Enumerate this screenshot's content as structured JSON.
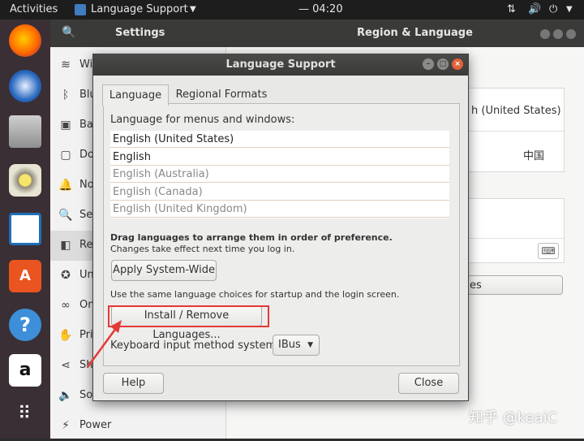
{
  "topbar": {
    "activities": "Activities",
    "app_menu": "Language Support",
    "clock": "— 04:20"
  },
  "settings": {
    "search_icon": "search-icon",
    "title": "Settings",
    "panel_title": "Region & Language",
    "sidebar": [
      {
        "label": "Wi",
        "icon": "wifi-icon"
      },
      {
        "label": "Blu",
        "icon": "bluetooth-icon"
      },
      {
        "label": "Ba",
        "icon": "background-icon"
      },
      {
        "label": "Do",
        "icon": "dock-icon"
      },
      {
        "label": "No",
        "icon": "notifications-icon"
      },
      {
        "label": "Se",
        "icon": "search-icon"
      },
      {
        "label": "Re",
        "icon": "region-icon"
      },
      {
        "label": "Un",
        "icon": "universal-access-icon"
      },
      {
        "label": "On",
        "icon": "online-accounts-icon"
      },
      {
        "label": "Pri",
        "icon": "privacy-icon"
      },
      {
        "label": "Sh",
        "icon": "sharing-icon"
      },
      {
        "label": "So",
        "icon": "sound-icon"
      },
      {
        "label": "Power",
        "icon": "power-icon"
      }
    ],
    "main": {
      "lang_value": "h (United States)",
      "formats_value": "中国",
      "manage_btn": "es"
    }
  },
  "dialog": {
    "title": "Language Support",
    "tabs": [
      "Language",
      "Regional Formats"
    ],
    "section_label": "Language for menus and windows:",
    "languages": [
      {
        "label": "English (United States)",
        "active": true
      },
      {
        "label": "English",
        "active": true
      },
      {
        "label": "English (Australia)",
        "active": false
      },
      {
        "label": "English (Canada)",
        "active": false
      },
      {
        "label": "English (United Kingdom)",
        "active": false
      }
    ],
    "drag_hint": "Drag languages to arrange them in order of preference.",
    "change_hint": "Changes take effect next time you log in.",
    "apply_btn": "Apply System-Wide",
    "apply_hint": "Use the same language choices for startup and the login screen.",
    "install_btn": "Install / Remove Languages...",
    "keyboard_label": "Keyboard input method system:",
    "keyboard_value": "IBus",
    "help_btn": "Help",
    "close_btn": "Close"
  },
  "watermark": "知乎 @keaiC",
  "colors": {
    "highlight": "#e53935",
    "accent": "#dd4814"
  }
}
